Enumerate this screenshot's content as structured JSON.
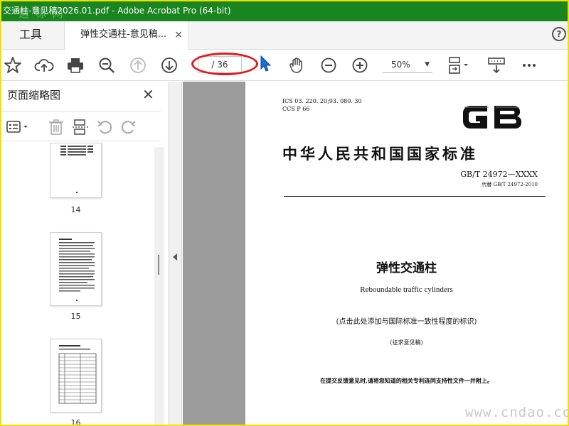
{
  "window": {
    "title": "交通柱-意见稿2026.01.pdf - Adobe Acrobat Pro (64-bit)",
    "overlay_watermark": "道 标 网"
  },
  "tabs": {
    "tools_label": "工具",
    "doc_label": "弹性交通柱-意见稿...",
    "close_glyph": "×",
    "help_glyph": "?"
  },
  "toolbar": {
    "page_indicator": "/ 36",
    "zoom_value": "50%",
    "zoom_caret": "▼"
  },
  "sidebar": {
    "title": "页面缩略图",
    "close_glyph": "✕",
    "thumbnails": [
      {
        "label": "14"
      },
      {
        "label": "15"
      },
      {
        "label": "16"
      }
    ]
  },
  "document": {
    "ics_line": "ICS  03. 220. 20;93. 080. 30",
    "ccs_line": "CCS  P 66",
    "logo_text": "GB",
    "standard_title": "中华人民共和国国家标准",
    "standard_number": "GB/T  24972—XXXX",
    "replaces": "代替  GB/T  24972-2010",
    "title_cn": "弹性交通柱",
    "title_en": "Reboundable traffic cylinders",
    "intl_note": "(点击此处添加与国际标准一致性程度的标识)",
    "draft_note": "(征求意见稿)",
    "notice": "在提交反馈意见时,请将您知道的相关专利连同支持性文件一并附上。"
  },
  "watermark_site": "www.cndao.com",
  "colors": {
    "titlebar": "#19851f",
    "frame_border": "#f2e000",
    "annotation_oval": "#e01b1b",
    "cursor": "#1a6fd6",
    "doc_background": "#9b9b9b"
  },
  "icons": [
    "star-icon",
    "cloud-upload-icon",
    "print-icon",
    "zoom-out-search-icon",
    "page-up-icon",
    "page-down-icon",
    "hand-icon",
    "zoom-out-icon",
    "zoom-in-icon",
    "fit-page-icon",
    "keyboard-icon",
    "more-icon",
    "options-icon",
    "trash-icon",
    "extract-icon",
    "undo-icon",
    "redo-icon"
  ]
}
